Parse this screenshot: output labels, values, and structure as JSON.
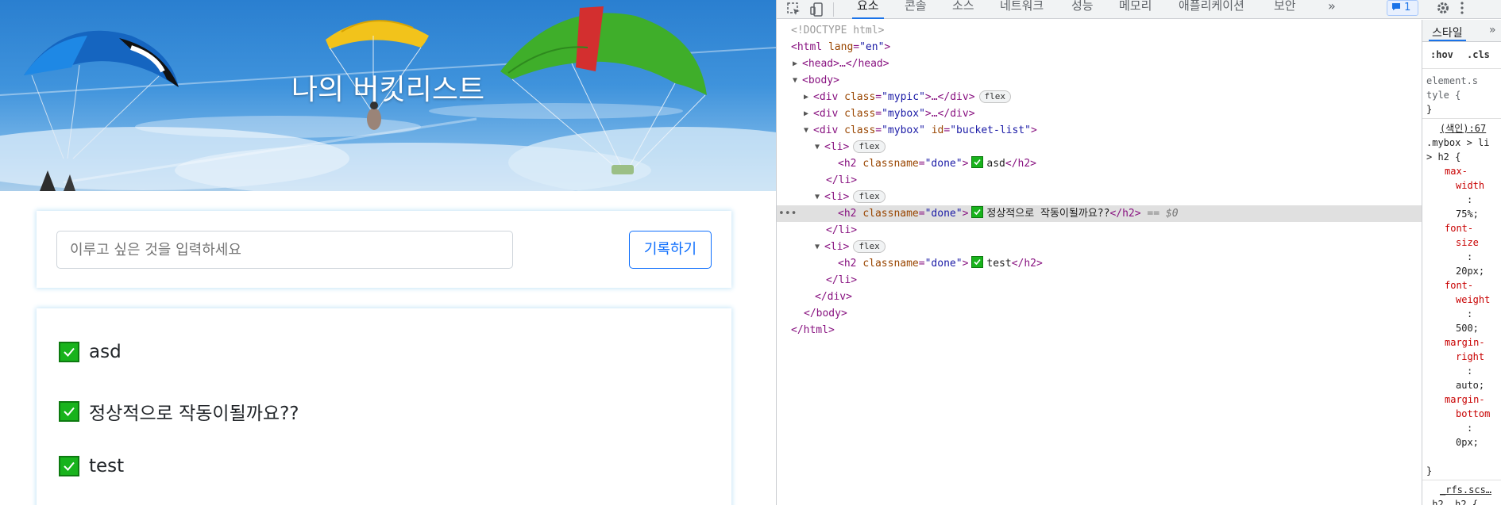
{
  "page": {
    "banner_title": "나의 버킷리스트",
    "input_placeholder": "이루고 싶은 것을 입력하세요",
    "save_button": "기록하기",
    "items": [
      {
        "text": "asd"
      },
      {
        "text": "정상적으로 작동이될까요??"
      },
      {
        "text": "test"
      }
    ]
  },
  "devtools": {
    "tabs": [
      "요소",
      "콘솔",
      "소스",
      "네트워크",
      "성능",
      "메모리",
      "애플리케이션",
      "보안"
    ],
    "more_tabs": "»",
    "issues_count": "1",
    "dom": {
      "doctype": "<!DOCTYPE html>",
      "html_open": "<html",
      "html_lang_attr": "lang",
      "html_lang_val": "\"en\"",
      "head": "<head>…</head>",
      "body_open": "<body>",
      "div_tag": "<div",
      "class_attr": "class",
      "mypic_val": "\"mypic\"",
      "mybox_val": "\"mybox\"",
      "ellipsis_close": ">…</div>",
      "flex_chip": "flex",
      "id_attr": "id",
      "bucket_list_val": "\"bucket-list\"",
      "li_open": "<li>",
      "li_close": "</li>",
      "h2_open": "<h2",
      "classname_attr": "classname",
      "done_val": "\"done\"",
      "h2_close": "</h2>",
      "item1": "asd",
      "item2": "정상적으로 작동이될까요??",
      "item3": "test",
      "selected_marker": "== $0",
      "div_close": "</div>",
      "body_close": "</body>",
      "html_close": "</html>"
    },
    "styles": {
      "tab": "스타일",
      "hov": ":hov",
      "cls": ".cls",
      "element_style_1": "element.s",
      "element_style_2": "tyle {",
      "close_brace": "}",
      "source_link": "(색인):67",
      "selector_1": ".mybox > li",
      "selector_2": "> h2 {",
      "rules": [
        {
          "prop": [
            "max-",
            "width"
          ],
          "value": "75%;"
        },
        {
          "prop": [
            "font-",
            "size"
          ],
          "value": "20px;"
        },
        {
          "prop": [
            "font-",
            "weight"
          ],
          "value": "500;"
        },
        {
          "prop": [
            "margin-",
            "right"
          ],
          "value": "auto;"
        },
        {
          "prop": [
            "margin-",
            "bottom"
          ],
          "value": "0px;"
        }
      ],
      "rfs_link": "_rfs.scs…",
      "h2_selector": ".h2, h2 {"
    }
  },
  "colors": {
    "accent": "#0d6efd",
    "check_green": "#18b31c",
    "devtools_blue": "#1a73e8"
  }
}
